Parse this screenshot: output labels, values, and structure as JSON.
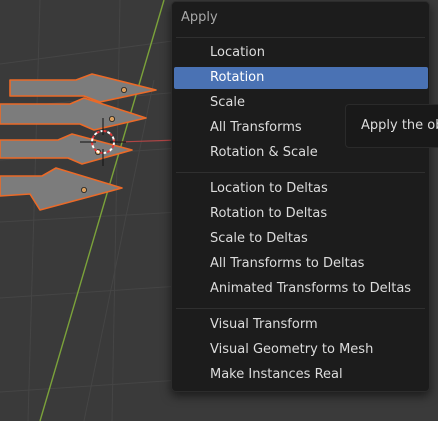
{
  "menu": {
    "title": "Apply",
    "groups": [
      [
        "Location",
        "Rotation",
        "Scale",
        "All Transforms",
        "Rotation & Scale"
      ],
      [
        "Location to Deltas",
        "Rotation to Deltas",
        "Scale to Deltas",
        "All Transforms to Deltas",
        "Animated Transforms to Deltas"
      ],
      [
        "Visual Transform",
        "Visual Geometry to Mesh",
        "Make Instances Real"
      ]
    ],
    "highlighted": "Rotation"
  },
  "tooltip": {
    "text": "Apply the ob"
  },
  "colors": {
    "viewport_bg": "#3a3a3a",
    "menu_bg": "#1c1c1c",
    "highlight": "#4a72b4",
    "selection_outline": "#e8692a",
    "y_axis": "#7ba23a",
    "x_axis": "#b04545"
  }
}
